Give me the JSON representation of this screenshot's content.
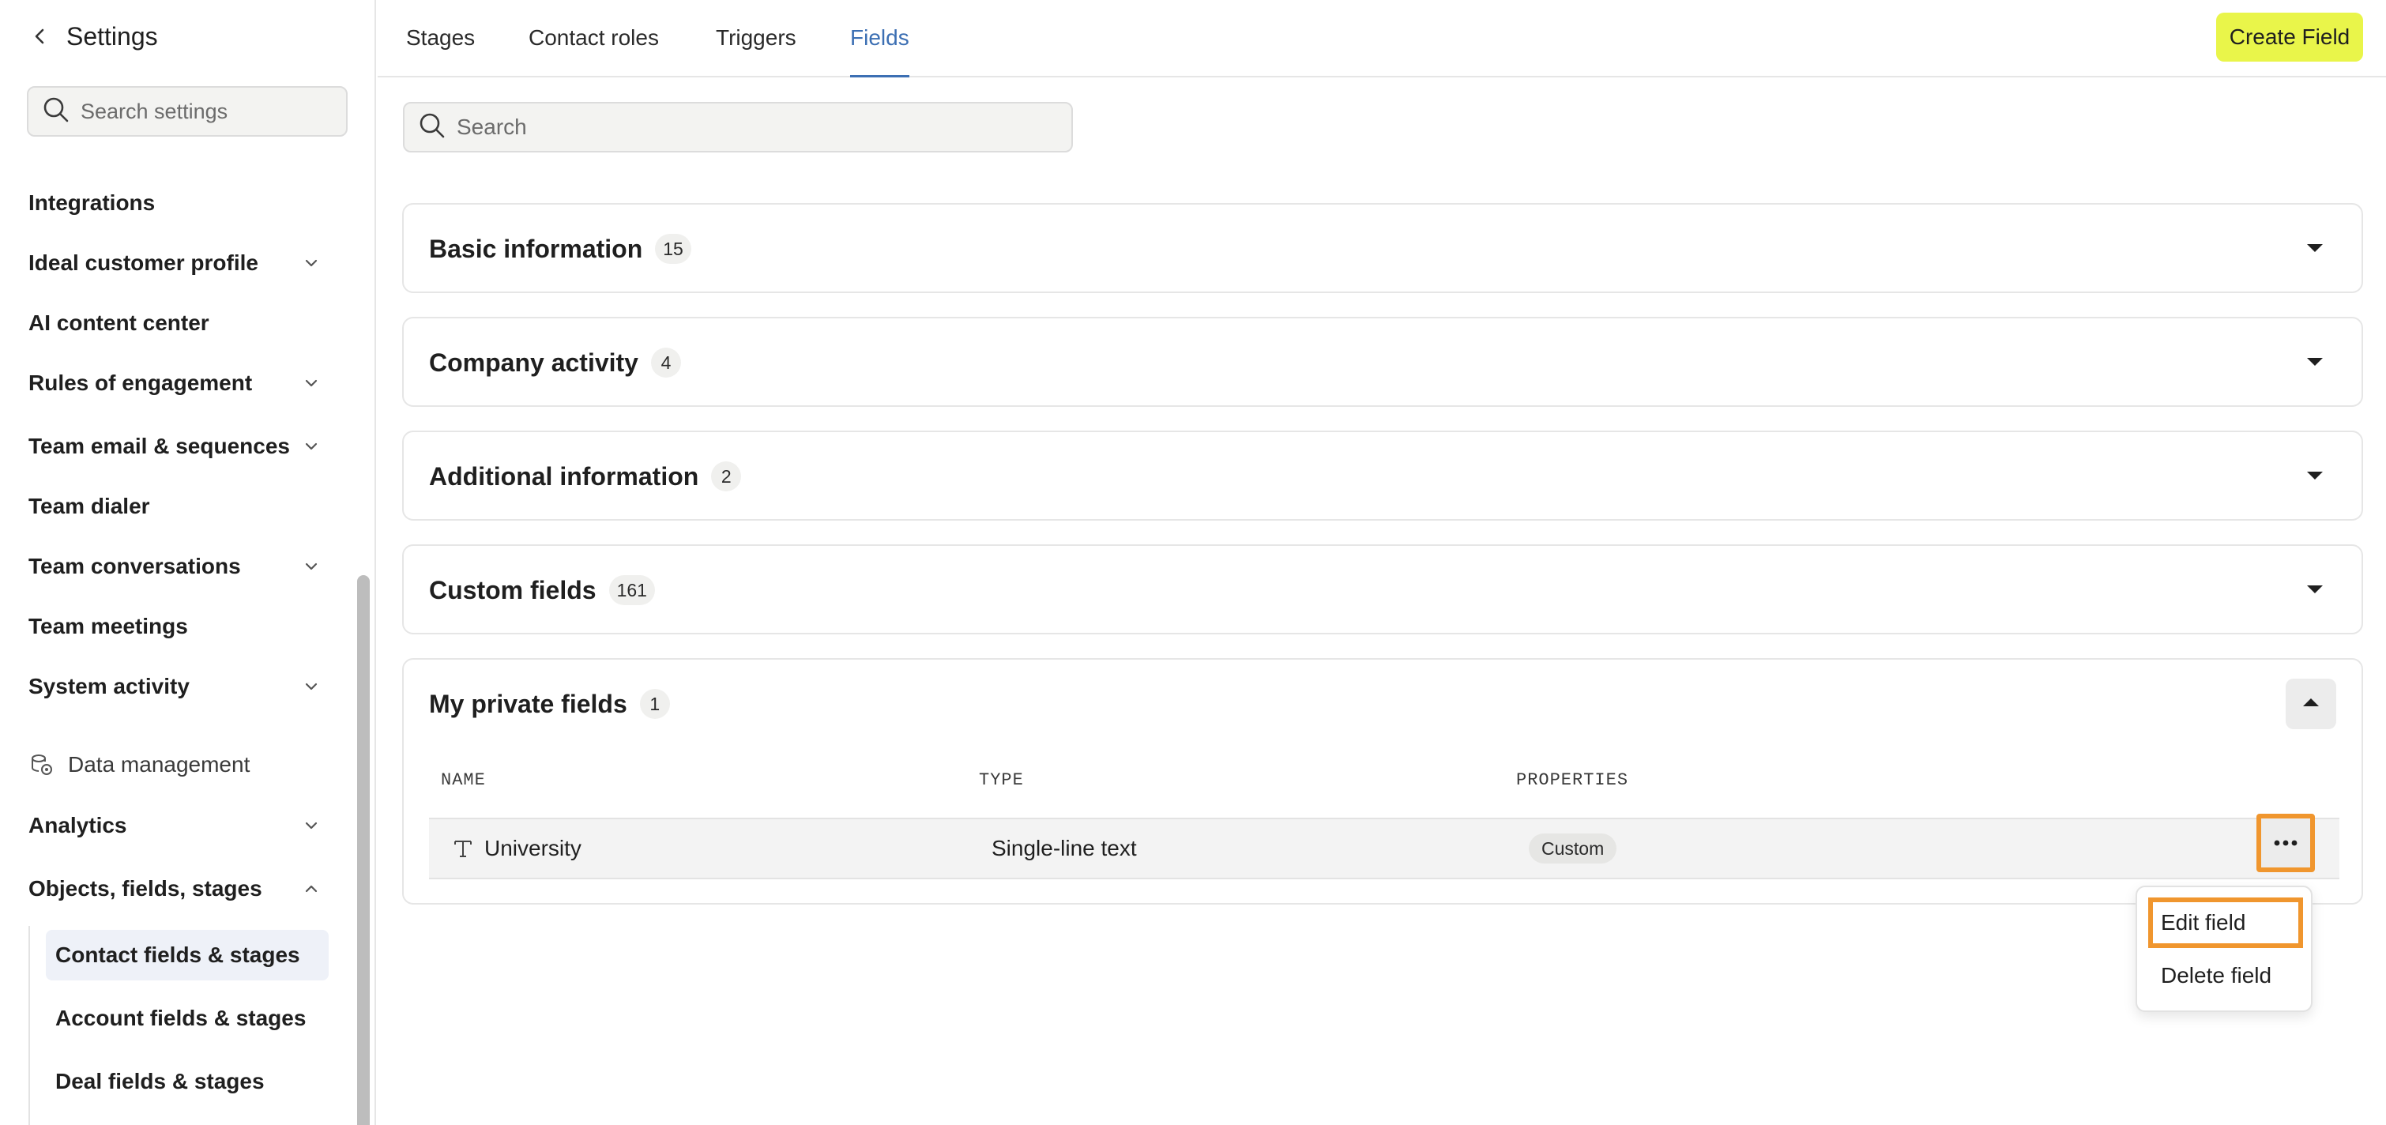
{
  "sidebar": {
    "title": "Settings",
    "search_placeholder": "Search settings",
    "items": [
      {
        "label": "Integrations",
        "has_chevron": false
      },
      {
        "label": "Ideal customer profile",
        "has_chevron": true
      },
      {
        "label": "AI content center",
        "has_chevron": false
      },
      {
        "label": "Rules of engagement",
        "has_chevron": true
      },
      {
        "label": "Team email & sequences",
        "has_chevron": true
      },
      {
        "label": "Team dialer",
        "has_chevron": false
      },
      {
        "label": "Team conversations",
        "has_chevron": true
      },
      {
        "label": "Team meetings",
        "has_chevron": false
      },
      {
        "label": "System activity",
        "has_chevron": true
      }
    ],
    "section_label": "Data management",
    "data_items": [
      {
        "label": "Analytics",
        "chevron": "down"
      },
      {
        "label": "Objects, fields, stages",
        "chevron": "up"
      }
    ],
    "sub_items": [
      {
        "label": "Contact fields & stages",
        "active": true
      },
      {
        "label": "Account fields & stages",
        "active": false
      },
      {
        "label": "Deal fields & stages",
        "active": false
      }
    ]
  },
  "tabs": [
    {
      "label": "Stages",
      "active": false
    },
    {
      "label": "Contact roles",
      "active": false
    },
    {
      "label": "Triggers",
      "active": false
    },
    {
      "label": "Fields",
      "active": true
    }
  ],
  "create_button": "Create Field",
  "main_search_placeholder": "Search",
  "sections": [
    {
      "title": "Basic information",
      "count": "15",
      "expanded": false
    },
    {
      "title": "Company activity",
      "count": "4",
      "expanded": false
    },
    {
      "title": "Additional information",
      "count": "2",
      "expanded": false
    },
    {
      "title": "Custom fields",
      "count": "161",
      "expanded": false
    },
    {
      "title": "My private fields",
      "count": "1",
      "expanded": true
    }
  ],
  "table": {
    "columns": [
      "NAME",
      "TYPE",
      "PROPERTIES"
    ],
    "rows": [
      {
        "name": "University",
        "type": "Single-line text",
        "property": "Custom",
        "icon": "text-type-icon"
      }
    ]
  },
  "menu": {
    "items": [
      "Edit field",
      "Delete field"
    ]
  },
  "colors": {
    "accent": "#3c6fb3",
    "create_button": "#e9f54a",
    "highlight": "#f0962e"
  }
}
